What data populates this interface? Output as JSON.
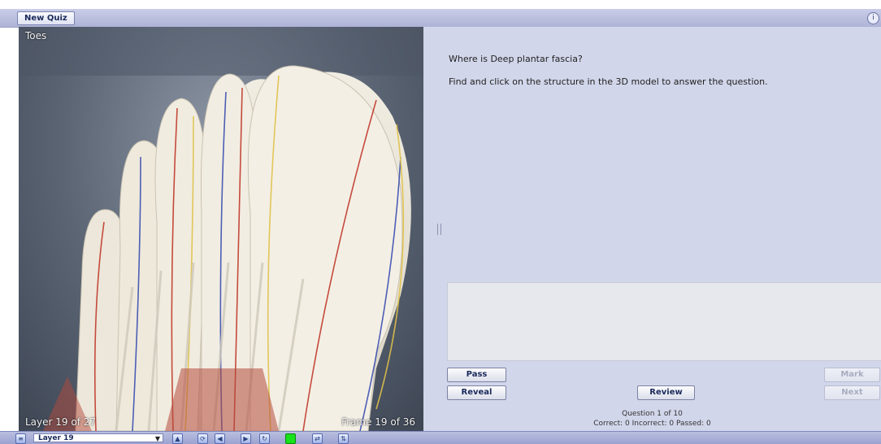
{
  "toolbar": {
    "new_quiz_label": "New Quiz",
    "corner_icon": "info-icon"
  },
  "viewer": {
    "region_label": "Toes",
    "layer_label": "Layer 19 of 27",
    "frame_label": "Frame 19 of 36",
    "image_kind": "3d-foot-anatomy-model"
  },
  "quiz": {
    "question": "Where is Deep plantar fascia?",
    "instruction": "Find and click on the structure in the 3D model to answer the question.",
    "answer_text": "",
    "buttons": {
      "pass": "Pass",
      "reveal": "Reveal",
      "review": "Review",
      "mark": "Mark",
      "next": "Next"
    },
    "progress": "Question 1 of 10",
    "score": "Correct: 0 Incorrect: 0 Passed: 0"
  },
  "bottom_bar": {
    "layer_select_value": "Layer 19",
    "tools": [
      "menu-icon",
      "layer-up-icon",
      "rotate-icon",
      "prev-frame-icon",
      "next-frame-icon",
      "spin-icon",
      "color-swatch-icon",
      "swap-icon",
      "sort-icon"
    ],
    "colors": {
      "swatch": "#17e21a",
      "accent": "#2a3c8f"
    }
  }
}
